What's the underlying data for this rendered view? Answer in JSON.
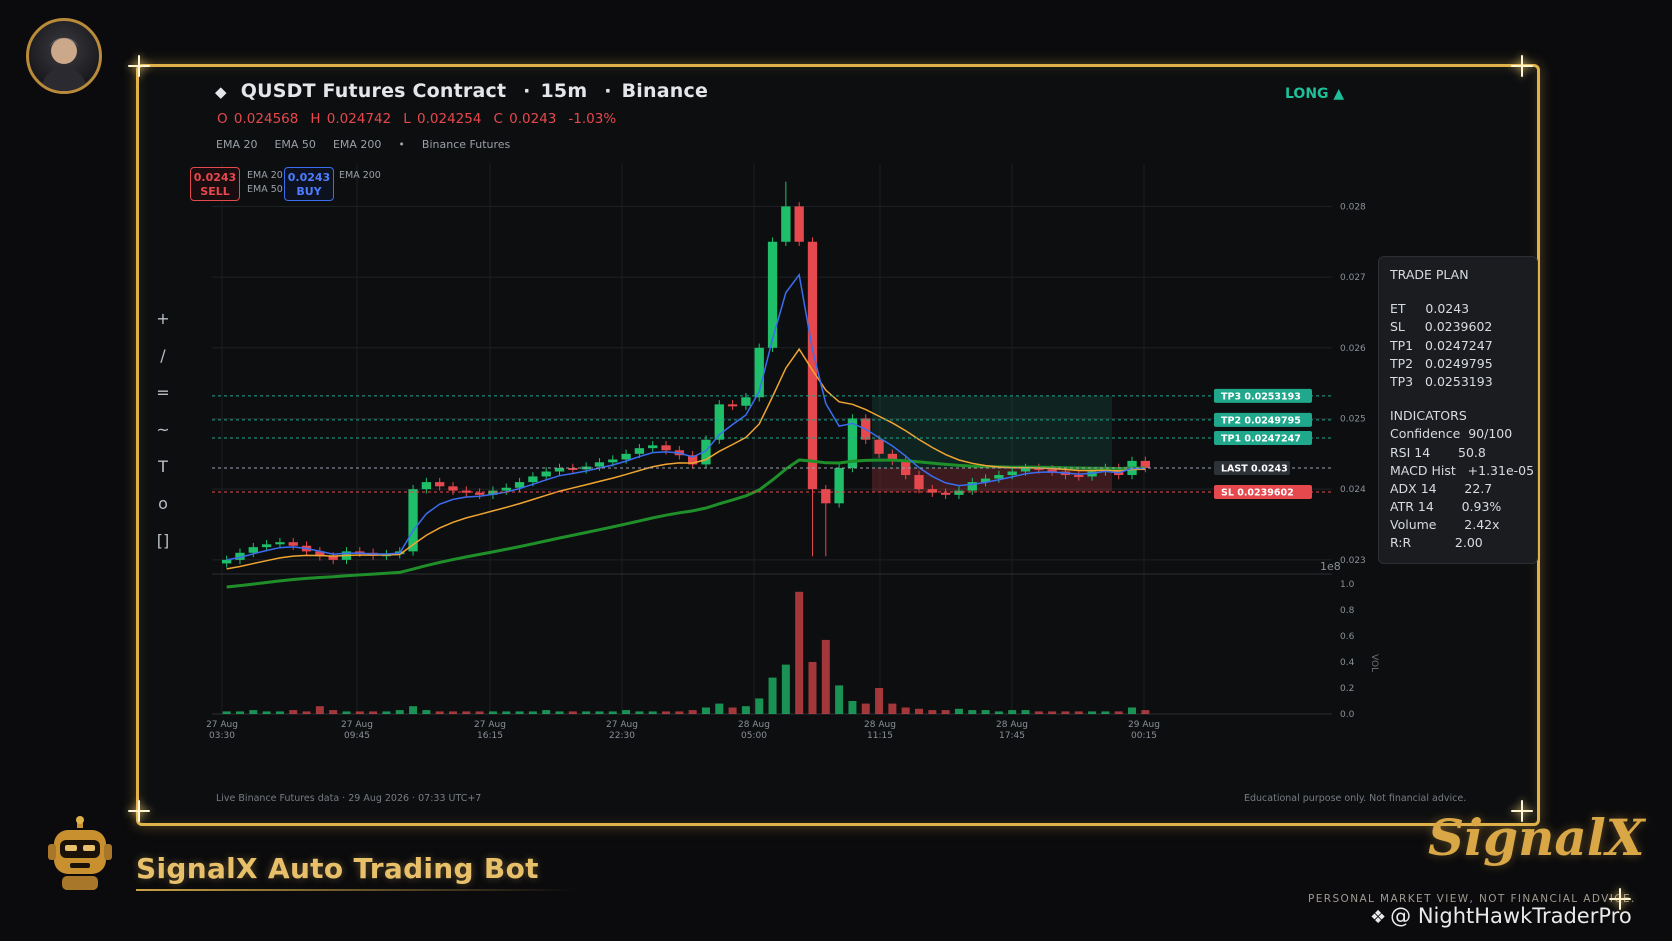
{
  "header": {
    "symbol_title": "QUSDT Futures Contract",
    "timeframe": "15m",
    "exchange": "Binance",
    "direction": "LONG ▲",
    "ohlc": {
      "o": "O 0.024568",
      "h": "H 0.024742",
      "l": "L 0.024254",
      "c": "C 0.0243",
      "change": "-1.03%"
    },
    "ema_legend": [
      "EMA 20",
      "EMA 50",
      "EMA 200",
      "•",
      "Binance Futures"
    ]
  },
  "toolbar": [
    "+",
    "/",
    "=",
    "~",
    "T",
    "o",
    "[]"
  ],
  "trade_buttons": {
    "sell_price": "0.0243",
    "sell_label": "SELL",
    "buy_price": "0.0243",
    "buy_label": "BUY",
    "mini_legend": [
      "EMA 20",
      "EMA 50",
      "EMA 200"
    ]
  },
  "levels": {
    "tp3": "TP3  0.0253193",
    "tp2": "TP2  0.0249795",
    "tp1": "TP1  0.0247247",
    "last": "LAST  0.0243",
    "sl": "SL  0.0239602"
  },
  "trade_plan": {
    "title": "TRADE PLAN",
    "rows": [
      "ET     0.0243",
      "SL     0.0239602",
      "TP1   0.0247247",
      "TP2   0.0249795",
      "TP3   0.0253193"
    ],
    "ind_title": "INDICATORS",
    "ind_rows": [
      "Confidence  90/100",
      "RSI 14       50.8",
      "MACD Hist   +1.31e-05",
      "ADX 14       22.7",
      "ATR 14       0.93%",
      "Volume       2.42x",
      "R:R           2.00"
    ]
  },
  "chart_data": {
    "type": "candlestick",
    "price_axis_ticks": [
      "0.028",
      "0.027",
      "0.026",
      "0.025",
      "0.024",
      "0.023"
    ],
    "price_axis_range": [
      0.0228,
      0.0286
    ],
    "exponent_label": "1e8",
    "volume_axis_ticks": [
      "1.0",
      "0.8",
      "0.6",
      "0.4",
      "0.2",
      "0.0"
    ],
    "volume_axis_label": "VOL",
    "x_ticks": [
      [
        "27 Aug",
        "03:30"
      ],
      [
        "27 Aug",
        "09:45"
      ],
      [
        "27 Aug",
        "16:15"
      ],
      [
        "27 Aug",
        "22:30"
      ],
      [
        "28 Aug",
        "05:00"
      ],
      [
        "28 Aug",
        "11:15"
      ],
      [
        "28 Aug",
        "17:45"
      ],
      [
        "29 Aug",
        "00:15"
      ]
    ],
    "candle_close_path": [
      0.023,
      0.0231,
      0.02318,
      0.02322,
      0.02325,
      0.0232,
      0.02312,
      0.02305,
      0.023,
      0.02312,
      0.0231,
      0.02306,
      0.02308,
      0.02312,
      0.024,
      0.0241,
      0.02404,
      0.02398,
      0.02395,
      0.02392,
      0.02398,
      0.02402,
      0.0241,
      0.02418,
      0.02425,
      0.0243,
      0.02428,
      0.02432,
      0.02438,
      0.02442,
      0.0245,
      0.02458,
      0.02462,
      0.02455,
      0.02448,
      0.02435,
      0.0247,
      0.0252,
      0.02518,
      0.0253,
      0.026,
      0.0275,
      0.028,
      0.0275,
      0.024,
      0.0238,
      0.0243,
      0.025,
      0.0247,
      0.0245,
      0.0244,
      0.0242,
      0.024,
      0.02395,
      0.02392,
      0.02398,
      0.0241,
      0.02415,
      0.0242,
      0.02425,
      0.0243,
      0.02428,
      0.02425,
      0.0242,
      0.02418,
      0.02425,
      0.0243,
      0.0242,
      0.0244,
      0.0243
    ],
    "volume_relative": [
      0.02,
      0.02,
      0.03,
      0.02,
      0.02,
      0.03,
      0.02,
      0.06,
      0.03,
      0.02,
      0.02,
      0.02,
      0.02,
      0.03,
      0.06,
      0.03,
      0.02,
      0.02,
      0.02,
      0.02,
      0.02,
      0.02,
      0.02,
      0.02,
      0.03,
      0.02,
      0.02,
      0.02,
      0.02,
      0.02,
      0.03,
      0.02,
      0.02,
      0.02,
      0.02,
      0.03,
      0.05,
      0.08,
      0.05,
      0.06,
      0.12,
      0.28,
      0.38,
      0.94,
      0.4,
      0.57,
      0.22,
      0.1,
      0.08,
      0.2,
      0.08,
      0.05,
      0.04,
      0.03,
      0.03,
      0.04,
      0.03,
      0.03,
      0.02,
      0.03,
      0.03,
      0.02,
      0.02,
      0.02,
      0.02,
      0.02,
      0.02,
      0.02,
      0.05,
      0.03
    ]
  },
  "footer": {
    "left": "Live Binance Futures data  ·  29 Aug 2026  · 07:33 UTC+7",
    "right": "Educational purpose only. Not financial advice."
  },
  "brand": {
    "name": "SignalX Auto Trading Bot",
    "logo": "SignalX",
    "tagline": "PERSONAL MARKET VIEW, NOT FINANCIAL ADVICE.",
    "handle": "@ NightHawkTraderPro"
  },
  "colors": {
    "gold": "#e0b24a",
    "up": "#1fbf6a",
    "down": "#e5484d",
    "ema20": "#3b6df0",
    "ema50": "#f0a531",
    "ema200": "#1f8f2a",
    "tp": "#1fa88c"
  }
}
